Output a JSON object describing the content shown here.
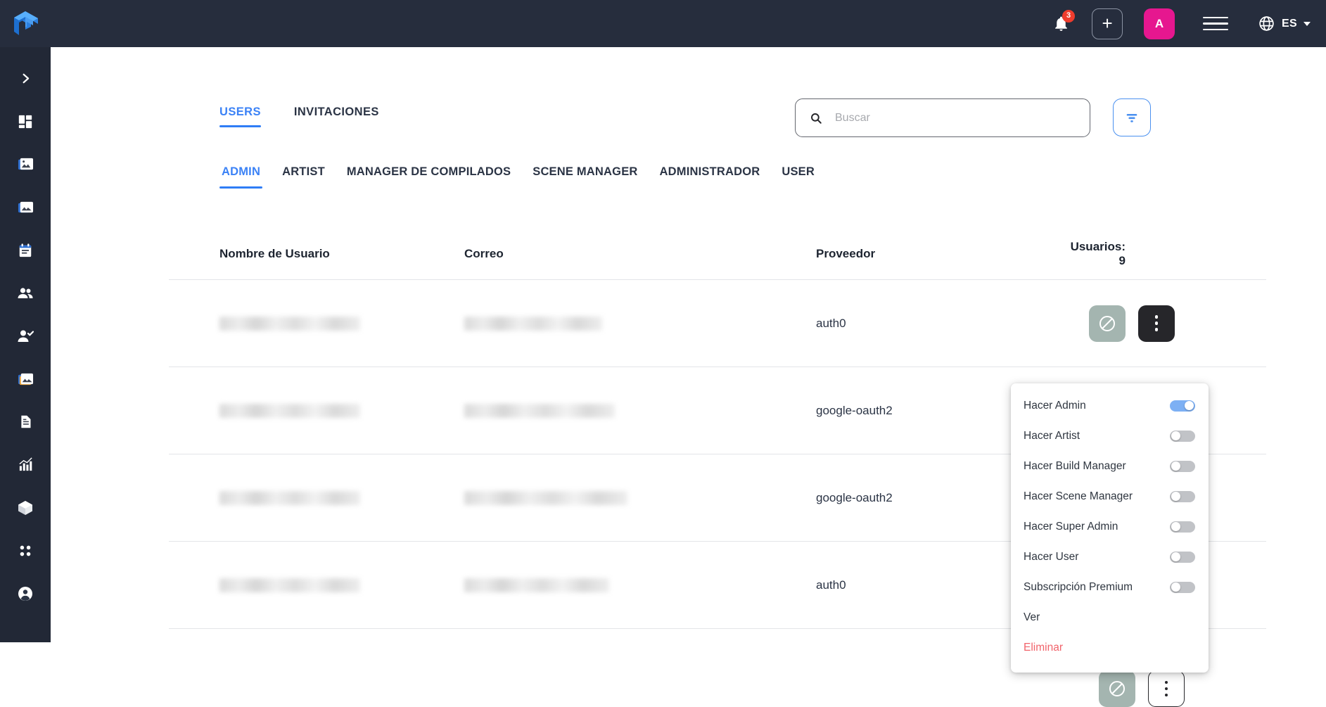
{
  "header": {
    "logo_icon": "cube-logo-icon",
    "notifications": {
      "icon": "bell-icon",
      "badge": "3"
    },
    "add_button": {
      "icon": "plus-icon",
      "label": "+"
    },
    "avatar": {
      "initial": "A",
      "color": "#e6178f"
    },
    "menu_icon": "hamburger-menu-icon",
    "language": {
      "icon": "globe-icon",
      "value": "ES",
      "caret": "chevron-down-icon"
    }
  },
  "sidebar": {
    "items": [
      {
        "icon": "chevron-right-icon",
        "name": "expand-sidebar"
      },
      {
        "icon": "dashboard-grid-icon",
        "name": "dashboard"
      },
      {
        "icon": "image-folder-icon",
        "name": "media-folder"
      },
      {
        "icon": "image-stack-icon",
        "name": "gallery"
      },
      {
        "icon": "calendar-icon",
        "name": "calendar"
      },
      {
        "icon": "people-group-icon",
        "name": "users"
      },
      {
        "icon": "person-check-icon",
        "name": "approvals"
      },
      {
        "icon": "image-layers-icon",
        "name": "collections"
      },
      {
        "icon": "document-icon",
        "name": "documents"
      },
      {
        "icon": "bar-chart-icon",
        "name": "analytics"
      },
      {
        "icon": "cube-3d-icon",
        "name": "assets"
      },
      {
        "icon": "apps-grid-icon",
        "name": "apps"
      },
      {
        "icon": "account-circle-icon",
        "name": "account"
      }
    ]
  },
  "main": {
    "top_tabs": [
      {
        "label": "USERS",
        "active": true
      },
      {
        "label": "INVITACIONES",
        "active": false
      }
    ],
    "search": {
      "icon": "search-icon",
      "placeholder": "Buscar",
      "value": ""
    },
    "filter_button": {
      "icon": "filter-icon"
    },
    "role_tabs": [
      {
        "label": "ADMIN",
        "active": true
      },
      {
        "label": "ARTIST",
        "active": false
      },
      {
        "label": "MANAGER DE COMPILADOS",
        "active": false
      },
      {
        "label": "SCENE MANAGER",
        "active": false
      },
      {
        "label": "ADMINISTRADOR",
        "active": false
      },
      {
        "label": "USER",
        "active": false
      }
    ],
    "table": {
      "headers": {
        "user": "Nombre de Usuario",
        "email": "Correo",
        "provider": "Proveedor",
        "count": "Usuarios: 9"
      },
      "rows": [
        {
          "username_redacted": true,
          "email_redacted": true,
          "provider": "auth0"
        },
        {
          "username_redacted": true,
          "email_redacted": true,
          "provider": "google-oauth2"
        },
        {
          "username_redacted": true,
          "email_redacted": true,
          "provider": "google-oauth2"
        },
        {
          "username_redacted": true,
          "email_redacted": true,
          "provider": "auth0"
        }
      ],
      "row_actions": {
        "ban_icon": "block-ban-icon",
        "more_icon": "more-vertical-icon"
      }
    },
    "context_menu": {
      "items": [
        {
          "label": "Hacer Admin",
          "toggle": true,
          "on": true
        },
        {
          "label": "Hacer Artist",
          "toggle": true,
          "on": false
        },
        {
          "label": "Hacer Build Manager",
          "toggle": true,
          "on": false
        },
        {
          "label": "Hacer Scene Manager",
          "toggle": true,
          "on": false
        },
        {
          "label": "Hacer Super Admin",
          "toggle": true,
          "on": false
        },
        {
          "label": "Hacer User",
          "toggle": true,
          "on": false
        },
        {
          "label": "Subscripción Premium",
          "toggle": true,
          "on": false
        },
        {
          "label": "Ver",
          "toggle": false,
          "on": false
        },
        {
          "label": "Eliminar",
          "toggle": false,
          "on": false,
          "danger": true
        }
      ]
    }
  },
  "colors": {
    "topbar": "#262d3d",
    "sidebar": "#222836",
    "accent_blue": "#2f7df6",
    "avatar_pink": "#e6178f",
    "badge_red": "#ef3c2d",
    "danger_red": "#f1636b",
    "toggle_on": "#7db0f4",
    "toggle_off": "#c1c3c7",
    "ban_button": "#a4b5b0",
    "more_button": "#26262a"
  }
}
